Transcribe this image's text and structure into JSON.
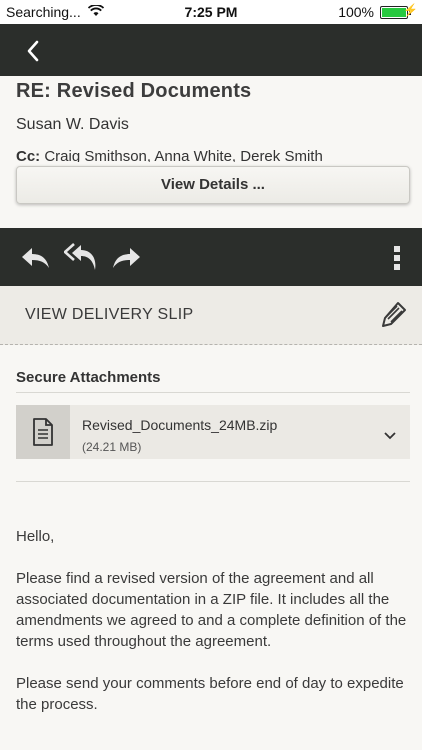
{
  "status_bar": {
    "carrier": "Searching...",
    "time": "7:25 PM",
    "battery": "100%"
  },
  "nav": {
    "back_icon": "chevron-left-icon"
  },
  "message": {
    "subject": "RE: Revised Documents",
    "sender": "Susan W. Davis",
    "cc_label": "Cc:",
    "cc_names": "Craig Smithson, Anna White, Derek Smith",
    "view_details_label": "View Details ..."
  },
  "actions": {
    "reply_icon": "reply-icon",
    "reply_all_icon": "reply-all-icon",
    "forward_icon": "forward-icon",
    "more_icon": "more-vertical-icon"
  },
  "delivery": {
    "label": "VIEW DELIVERY SLIP",
    "edit_icon": "pencil-icon"
  },
  "attachments": {
    "title": "Secure Attachments",
    "items": [
      {
        "name": "Revised_Documents_24MB.zip",
        "size": "(24.21 MB)"
      }
    ]
  },
  "body": {
    "paragraphs": [
      "Hello,",
      "Please find a revised version of the agreement and all associated documentation in a ZIP file. It includes all the amendments we agreed to and a complete definition of the terms used throughout the agreement.",
      "Please send your comments before end of day to expedite the process."
    ]
  },
  "colors": {
    "bar_dark": "#2b2e2b",
    "background": "#f8f7f4",
    "delivery_bg": "#edebe6",
    "battery_green": "#27c93f"
  }
}
